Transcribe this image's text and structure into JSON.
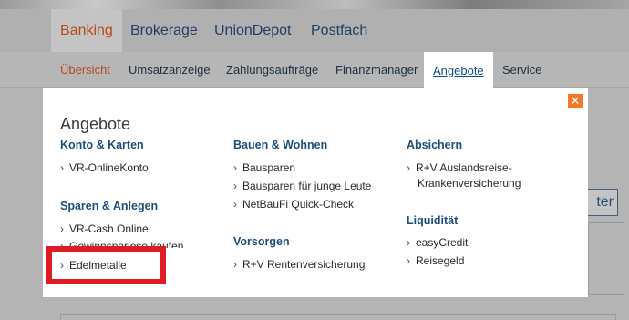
{
  "main_nav": {
    "tabs": [
      {
        "label": "Banking",
        "active": true
      },
      {
        "label": "Brokerage",
        "active": false
      },
      {
        "label": "UnionDepot",
        "active": false
      },
      {
        "label": "Postfach",
        "active": false
      }
    ]
  },
  "sub_nav": {
    "tabs": [
      {
        "label": "Übersicht"
      },
      {
        "label": "Umsatzanzeige"
      },
      {
        "label": "Zahlungsaufträge"
      },
      {
        "label": "Finanzmanager"
      },
      {
        "label": "Angebote",
        "active": true
      },
      {
        "label": "Service"
      }
    ]
  },
  "background": {
    "button_fragment": "ter"
  },
  "modal": {
    "title": "Angebote",
    "close_icon": "close-icon",
    "columns": [
      {
        "groups": [
          {
            "heading": "Konto & Karten",
            "items": [
              "VR-OnlineKonto"
            ]
          },
          {
            "heading": "Sparen & Anlegen",
            "items": [
              "VR-Cash Online",
              "Gewinnsparlose kaufen",
              "Edelmetalle"
            ]
          }
        ]
      },
      {
        "groups": [
          {
            "heading": "Bauen & Wohnen",
            "items": [
              "Bausparen",
              "Bausparen für junge Leute",
              "NetBauFi Quick-Check"
            ]
          },
          {
            "heading": "Vorsorgen",
            "items": [
              "R+V Rentenversicherung"
            ]
          }
        ]
      },
      {
        "groups": [
          {
            "heading": "Absichern",
            "items": [
              "R+V Auslandsreise-Krankenversicherung"
            ]
          },
          {
            "heading": "Liquidität",
            "items": [
              "easyCredit",
              "Reisegeld"
            ]
          }
        ]
      }
    ],
    "item_wrap": {
      "line1": "R+V Auslandsreise-",
      "line2": "Krankenversicherung"
    }
  },
  "colors": {
    "accent_orange": "#f07a2a",
    "link_blue": "#1f4e79",
    "highlight_red": "#e01b24"
  }
}
